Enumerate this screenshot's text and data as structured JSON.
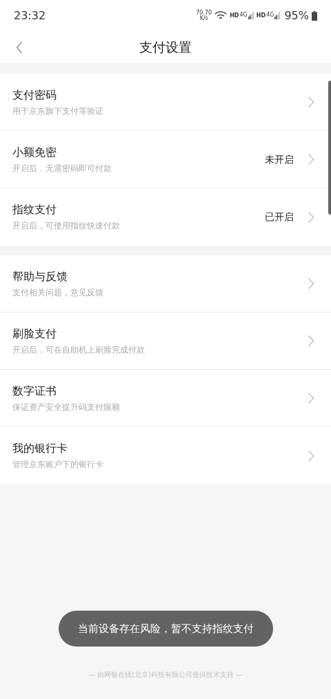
{
  "status_bar": {
    "time": "23:32",
    "speed_value": "70.70",
    "speed_unit": "K/s",
    "sim_slots": [
      {
        "hd": "HD",
        "network": "4G"
      },
      {
        "hd": "HD",
        "network": "4G"
      }
    ],
    "battery": "95%"
  },
  "header": {
    "title": "支付设置"
  },
  "groups": [
    {
      "items": [
        {
          "title": "支付密码",
          "subtitle": "用于京东旗下支付等验证"
        },
        {
          "title": "小额免密",
          "subtitle": "开启后，无需密码即可付款",
          "status": "未开启"
        },
        {
          "title": "指纹支付",
          "subtitle": "开启后，可使用指纹快速付款",
          "status": "已开启"
        }
      ]
    },
    {
      "items": [
        {
          "title": "帮助与反馈",
          "subtitle": "支付相关问题，意见反馈"
        },
        {
          "title": "刷脸支付",
          "subtitle": "开启后，可在自助机上刷脸完成付款"
        },
        {
          "title": "数字证书",
          "subtitle": "保证资产安全提升码支付限额"
        },
        {
          "title": "我的银行卡",
          "subtitle": "管理京东账户下的银行卡"
        }
      ]
    }
  ],
  "toast": "当前设备存在风险，暂不支持指纹支付",
  "footer": "— 由网银在线(北京)科技有限公司提供技术支持 —"
}
